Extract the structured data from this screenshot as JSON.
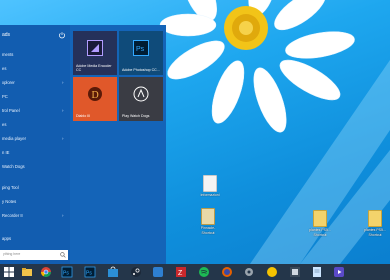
{
  "start_menu": {
    "user_label": "ads",
    "items": [
      {
        "label": "ments",
        "arrow": false
      },
      {
        "label": "es",
        "arrow": false
      },
      {
        "label": "xplorer",
        "arrow": true
      },
      {
        "label": "PC",
        "arrow": false
      },
      {
        "label": "trol Panel",
        "arrow": true
      },
      {
        "label": "es",
        "arrow": false
      },
      {
        "label": "media player",
        "arrow": true
      },
      {
        "label": "n IE",
        "arrow": false
      },
      {
        "label": "Watch Dogs",
        "arrow": false
      },
      {
        "label": "ping Tool",
        "arrow": false
      },
      {
        "label": "y Notes",
        "arrow": false
      },
      {
        "label": "Recorder II",
        "arrow": true
      },
      {
        "label": "apps",
        "arrow": false
      }
    ],
    "search_placeholder": "ything here",
    "tiles": [
      {
        "label": "Adobe Media Encoder CC",
        "bg": "#25315a",
        "icon": "adobe-media-encoder-icon"
      },
      {
        "label": "Adobe Photoshop CC...",
        "bg": "#0f4b7a",
        "icon": "photoshop-icon"
      },
      {
        "label": "Diablo III",
        "bg": "#e0582a",
        "icon": "diablo-icon"
      },
      {
        "label": "Play Watch Dogs",
        "bg": "#3a3c44",
        "icon": "watch-dogs-icon"
      }
    ]
  },
  "desktop": {
    "icons": [
      {
        "label": "Informazioni"
      },
      {
        "label": "Pinnacle-\nShortcut"
      },
      {
        "label": "plantes PS5...\nShortcut"
      },
      {
        "label": "plantes PS5...\nShortcut"
      }
    ]
  },
  "taskbar": {
    "apps": [
      {
        "name": "start-button",
        "color": "#ffffff"
      },
      {
        "name": "file-explorer",
        "color": "#f3c44a"
      },
      {
        "name": "chrome",
        "color": "#4a90e2"
      },
      {
        "name": "photoshop",
        "color": "#0f4b7a"
      },
      {
        "name": "photoshop-2",
        "color": "#0f4b7a"
      },
      {
        "name": "store",
        "color": "#2b8fd6"
      },
      {
        "name": "steam",
        "color": "#1b2838"
      },
      {
        "name": "app-blue",
        "color": "#2e7fd0"
      },
      {
        "name": "filezilla",
        "color": "#c8282c"
      },
      {
        "name": "spotify",
        "color": "#1db954"
      },
      {
        "name": "firefox",
        "color": "#e66000"
      },
      {
        "name": "settings",
        "color": "#9aa4ad"
      },
      {
        "name": "emoji-app",
        "color": "#f5c300"
      },
      {
        "name": "app-dark",
        "color": "#3a4a5a"
      },
      {
        "name": "notes",
        "color": "#cde6ff"
      },
      {
        "name": "calculator",
        "color": "#6a6a9a"
      },
      {
        "name": "media",
        "color": "#5a4ac8"
      }
    ]
  }
}
